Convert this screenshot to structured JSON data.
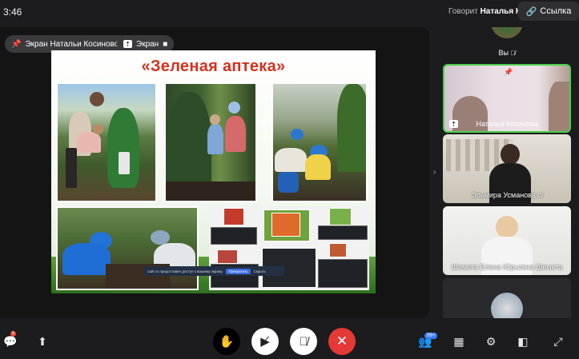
{
  "status": {
    "time": "3:46"
  },
  "header": {
    "speaker_prefix": "Говорит",
    "speaker_name": "Наталья К.",
    "link_label": "Ссылка"
  },
  "stage": {
    "owner_chip": "Экран Натальи Косиновой",
    "screen_chip": "Экран"
  },
  "slide": {
    "title": "«Зеленая аптека»",
    "tooltip_text": "сайт.ru предоставил доступ к вашему экрану.",
    "tooltip_button": "Прекратить",
    "tooltip_hide": "Скрыть"
  },
  "participants": [
    {
      "name": "Вы",
      "muted": true
    },
    {
      "name": "Наталья Косинова",
      "pinned": true
    },
    {
      "name": "Эльмира Усманова",
      "muted": true
    },
    {
      "name": "Шемета Елена Юрьевна Шемета"
    },
    {
      "name": ""
    }
  ],
  "controls": {
    "participants_count": "99+",
    "chat_badge": "5"
  },
  "colors": {
    "accent_red": "#e53935",
    "active_border": "#4ccf4c",
    "title_red": "#d5301d"
  }
}
